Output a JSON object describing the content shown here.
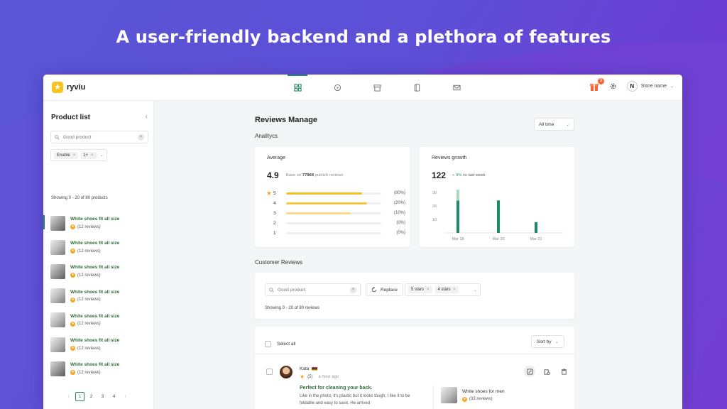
{
  "hero": {
    "title": "A user-friendly backend and a plethora of features"
  },
  "app": {
    "logo_text": "ryviu",
    "nav_icons": [
      "dashboard-icon",
      "chat-icon",
      "archive-icon",
      "book-icon",
      "mail-icon"
    ],
    "gift_badge": "3",
    "store_initial": "N",
    "store_name": "Store name"
  },
  "sidebar": {
    "title": "Product list",
    "search_placeholder": "Good product",
    "filter_chips": [
      "Enable",
      "1+"
    ],
    "showing": "Showing 0 - 20 of 80 products",
    "products": [
      {
        "name": "White shoes fit all size",
        "reviews": "(12 reviews)"
      },
      {
        "name": "White shoes fit all size",
        "reviews": "(12 reviews)"
      },
      {
        "name": "White shoes fit all size",
        "reviews": "(12 reviews)"
      },
      {
        "name": "White shoes fit all size",
        "reviews": "(12 reviews)"
      },
      {
        "name": "White shoes fit all size",
        "reviews": "(12 reviews)"
      },
      {
        "name": "White shoes fit all size",
        "reviews": "(12 reviews)"
      },
      {
        "name": "White shoes fit all size",
        "reviews": "(12 reviews)"
      }
    ],
    "pages": [
      "1",
      "2",
      "3",
      "4"
    ],
    "current_page": "1"
  },
  "main": {
    "title": "Reviews Manage",
    "analytics_label": "Analitycs",
    "time_filter": "All time",
    "average": {
      "label": "Average",
      "value": "4.9",
      "note_prefix": "Base on",
      "note_count": "77964",
      "note_suffix": "publish reviews",
      "rows": [
        {
          "level": "5",
          "pct_label": "(80%)",
          "fill": 0.8,
          "color": "#f7c02a"
        },
        {
          "level": "4",
          "pct_label": "(20%)",
          "fill": 0.85,
          "color": "#f8c73d"
        },
        {
          "level": "3",
          "pct_label": "(10%)",
          "fill": 0.68,
          "color": "#fbdc86"
        },
        {
          "level": "2",
          "pct_label": "(0%)",
          "fill": 0.0,
          "color": "#fbdc86"
        },
        {
          "level": "1",
          "pct_label": "(0%)",
          "fill": 0.0,
          "color": "#fbdc86"
        }
      ]
    },
    "growth": {
      "label": "Reviews growth",
      "value": "122",
      "change": "+ 9%",
      "change_suffix": "vs last week"
    },
    "customer_reviews_label": "Customer Reviews",
    "filter": {
      "search_placeholder": "Good product",
      "replace_label": "Replace",
      "star_chips": [
        "5 stars",
        "4 stars"
      ],
      "showing": "Showing 0 - 20 of 80 reviews"
    },
    "list": {
      "select_all": "Select all",
      "sort_label": "Sort by",
      "review": {
        "author": "Kata",
        "rating": "(5)",
        "ago": "a hour ago",
        "title": "Perfect for cleaning your back.",
        "body": "Like in the photo, it's plastic but it looks tough, I like it to be foldable and easy to save. He arrived",
        "product_name": "White shoes for men",
        "product_reviews": "(33 reviews)"
      }
    }
  },
  "chart_data": {
    "type": "bar",
    "categories": [
      "Mar 18",
      "Mar 20",
      "Mar 21"
    ],
    "series": [
      {
        "values": [
          24,
          24,
          8
        ]
      },
      {
        "values": [
          8,
          0,
          0
        ]
      }
    ],
    "stacked": true,
    "yticks": [
      10,
      20,
      30
    ],
    "ylim": [
      0,
      32
    ],
    "colors": [
      "#1f8a68",
      "#a8dcc0"
    ],
    "grid": false
  }
}
